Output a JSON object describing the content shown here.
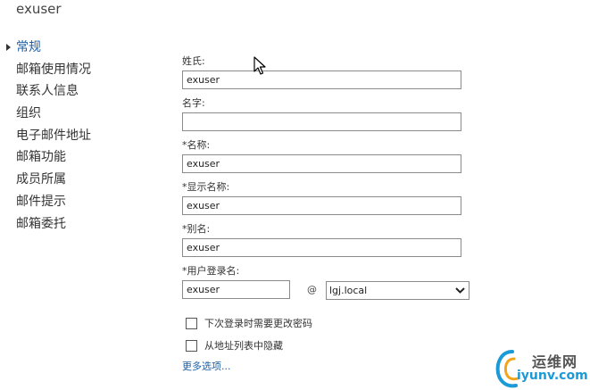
{
  "window": {
    "title": "exuser"
  },
  "nav": {
    "items": [
      {
        "label": "常规",
        "active": true
      },
      {
        "label": "邮箱使用情况"
      },
      {
        "label": "联系人信息"
      },
      {
        "label": "组织"
      },
      {
        "label": "电子邮件地址"
      },
      {
        "label": "邮箱功能"
      },
      {
        "label": "成员所属"
      },
      {
        "label": "邮件提示"
      },
      {
        "label": "邮箱委托"
      }
    ]
  },
  "form": {
    "last_name": {
      "label": "姓氏:",
      "value": "exuser"
    },
    "first_name": {
      "label": "名字:",
      "value": ""
    },
    "name": {
      "label": "*名称:",
      "value": "exuser"
    },
    "display_name": {
      "label": "*显示名称:",
      "value": "exuser"
    },
    "alias": {
      "label": "*别名:",
      "value": "exuser"
    },
    "logon_name": {
      "label": "*用户登录名:",
      "value": "exuser",
      "at": "@",
      "domain": "lgj.local"
    },
    "checkbox_change_password": {
      "label": "下次登录时需要更改密码",
      "checked": false
    },
    "checkbox_hide_from_list": {
      "label": "从地址列表中隐藏",
      "checked": false
    },
    "more_options": "更多选项..."
  },
  "watermark": {
    "text_cn": "运维网",
    "text_en": "iyunv.com"
  },
  "colors": {
    "link": "#1d5fa4",
    "watermark_blue": "#1a9ad6"
  }
}
